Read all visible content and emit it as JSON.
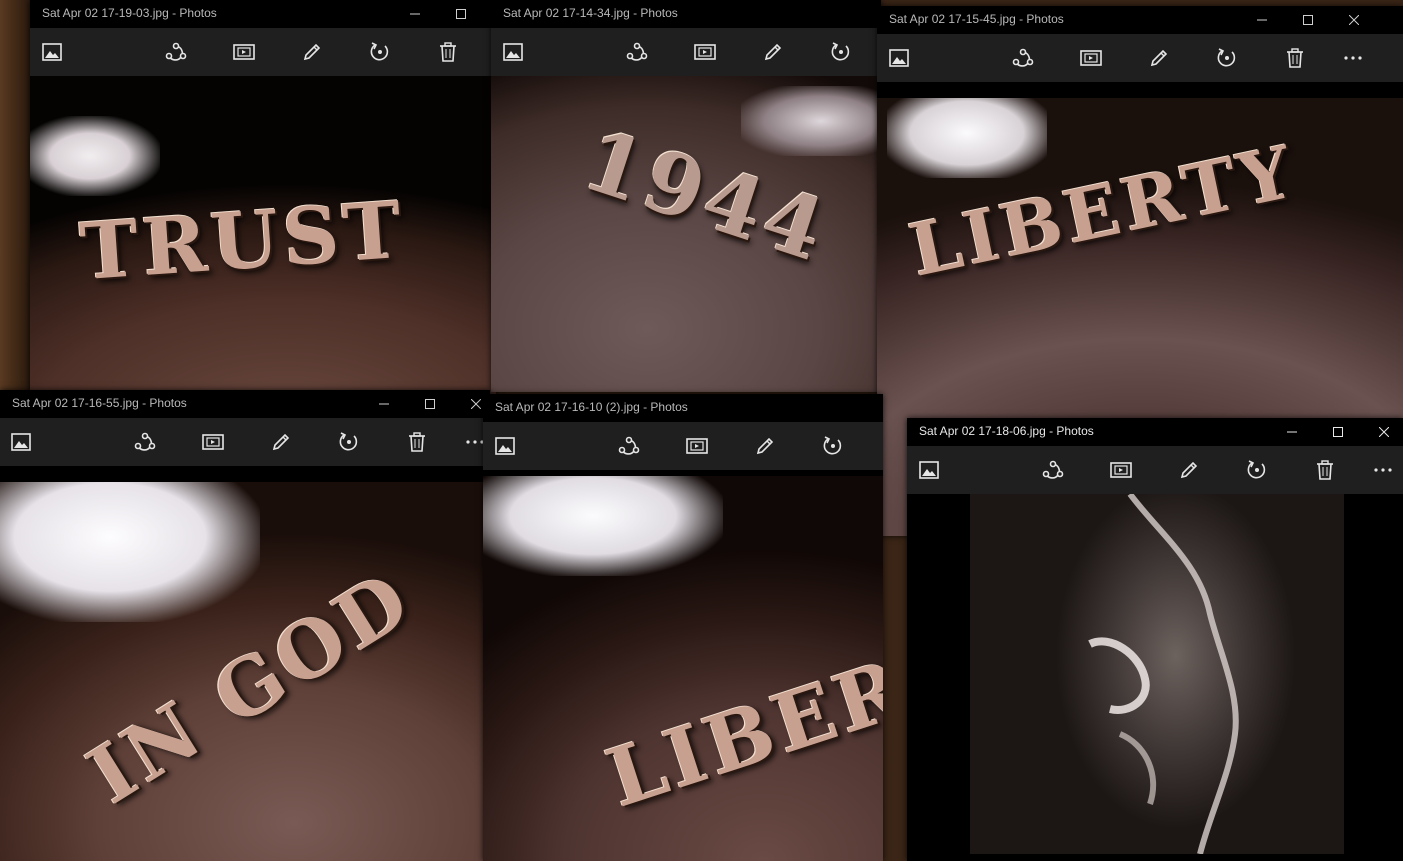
{
  "windows": [
    {
      "title": "Sat Apr 02 17-19-03.jpg - Photos",
      "coin_text": "TRUST"
    },
    {
      "title": "Sat Apr 02 17-14-34.jpg - Photos",
      "coin_text": "1944"
    },
    {
      "title": "Sat Apr 02 17-15-45.jpg - Photos",
      "coin_text": "LIBERTY"
    },
    {
      "title": "Sat Apr 02 17-16-55.jpg - Photos",
      "coin_text": "IN GOD"
    },
    {
      "title": "Sat Apr 02 17-16-10 (2).jpg - Photos",
      "coin_text": "LIBER"
    },
    {
      "title": "Sat Apr 02 17-18-06.jpg - Photos",
      "coin_text": ""
    }
  ],
  "toolbar_icons": [
    "picture-icon",
    "share-icon",
    "slideshow-icon",
    "edit-pencil-icon",
    "rotate-icon",
    "delete-icon",
    "more-icon"
  ],
  "colors": {
    "titlebar": "#000000",
    "toolbar": "#1f1f1f",
    "icon": "#e6e6e6",
    "title_text": "#b9b9b9"
  }
}
